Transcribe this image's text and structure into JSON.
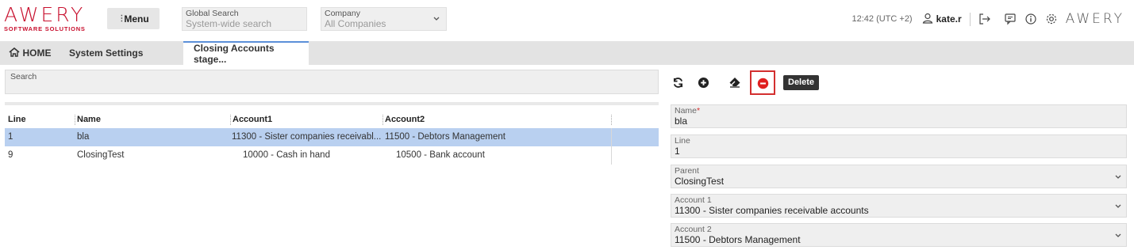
{
  "header": {
    "logo_main": "AWERY",
    "logo_sub": "SOFTWARE SOLUTIONS",
    "menu_label": "Menu",
    "global_search_label": "Global Search",
    "global_search_placeholder": "System-wide search",
    "company_label": "Company",
    "company_value": "All Companies",
    "time": "12:42 (UTC +2)",
    "user": "kate.r",
    "brand_right": "AWERY"
  },
  "tabs": [
    {
      "label": "HOME"
    },
    {
      "label": "System Settings"
    },
    {
      "label": "Closing Accounts stage..."
    }
  ],
  "search": {
    "label": "Search"
  },
  "table": {
    "columns": [
      "Line",
      "Name",
      "Account1",
      "Account2"
    ],
    "rows": [
      {
        "line": "1",
        "name": "bla",
        "account1": "11300 - Sister companies receivabl...",
        "account2": "11500 - Debtors Management",
        "selected": true
      },
      {
        "line": "9",
        "name": "ClosingTest",
        "account1": "10000 - Cash in hand",
        "account2": "10500 - Bank account",
        "selected": false
      }
    ]
  },
  "toolbar": {
    "tooltip": "Delete"
  },
  "form": {
    "name_label": "Name",
    "name_required": "*",
    "name_value": "bla",
    "line_label": "Line",
    "line_value": "1",
    "parent_label": "Parent",
    "parent_value": "ClosingTest",
    "account1_label": "Account 1",
    "account1_value": "11300 - Sister companies receivable accounts",
    "account2_label": "Account 2",
    "account2_value": "11500 - Debtors Management"
  },
  "colors": {
    "brand": "#c8102e",
    "selection": "#b9d0f0",
    "delete": "#d32f2f",
    "active_tab_border": "#5b8fd8"
  }
}
